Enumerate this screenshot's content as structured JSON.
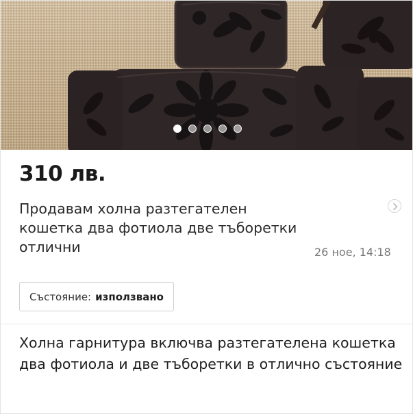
{
  "listing": {
    "photo": {
      "dots": [
        {
          "active": true
        },
        {
          "active": false
        },
        {
          "active": false
        },
        {
          "active": false
        },
        {
          "active": false
        }
      ]
    },
    "price": "310 лв.",
    "title": "Продавам холна разтегателен кошетка два фотиола две тъборетки отлични",
    "date": "26 ное, 14:18",
    "condition": {
      "label": "Състояние:",
      "value": "използвано"
    },
    "description": "Холна гарнитура включва разтегателена кошетка два фотиола и две тъборетки в отлично състояние"
  },
  "colors": {
    "upholstery": "#2e2524",
    "pattern": "#171112",
    "carpet": "#cdb491",
    "date": "#7a7a7a"
  },
  "icons": {
    "chevron": "chevron-right-icon"
  }
}
